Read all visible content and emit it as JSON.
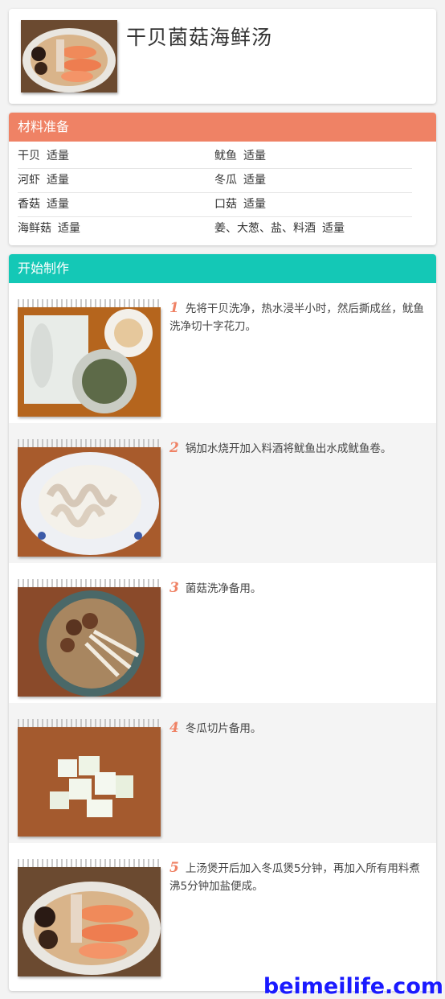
{
  "recipe": {
    "title": "干贝菌菇海鲜汤"
  },
  "ingredients": {
    "header": "材料准备",
    "rows": [
      [
        {
          "name": "干贝",
          "amount": "适量"
        },
        {
          "name": "鱿鱼",
          "amount": "适量"
        }
      ],
      [
        {
          "name": "河虾",
          "amount": "适量"
        },
        {
          "name": "冬瓜",
          "amount": "适量"
        }
      ],
      [
        {
          "name": "香菇",
          "amount": "适量"
        },
        {
          "name": "口菇",
          "amount": "适量"
        }
      ],
      [
        {
          "name": "海鲜菇",
          "amount": "适量"
        },
        {
          "name": "姜、大葱、盐、料酒",
          "amount": "适量"
        }
      ]
    ]
  },
  "steps": {
    "header": "开始制作",
    "items": [
      {
        "num": "1",
        "text": "先将干贝洗净，热水浸半小时，然后撕成丝，鱿鱼洗净切十字花刀。"
      },
      {
        "num": "2",
        "text": "锅加水烧开加入料酒将鱿鱼出水成鱿鱼卷。"
      },
      {
        "num": "3",
        "text": "菌菇洗净备用。"
      },
      {
        "num": "4",
        "text": "冬瓜切片备用。"
      },
      {
        "num": "5",
        "text": "上汤煲开后加入冬瓜煲5分钟，再加入所有用料煮沸5分钟加盐便成。"
      }
    ]
  },
  "watermark": "beimeilife.com",
  "colors": {
    "ingredients_header": "#ef8265",
    "steps_header": "#14c8b6",
    "step_number": "#ef8265"
  }
}
